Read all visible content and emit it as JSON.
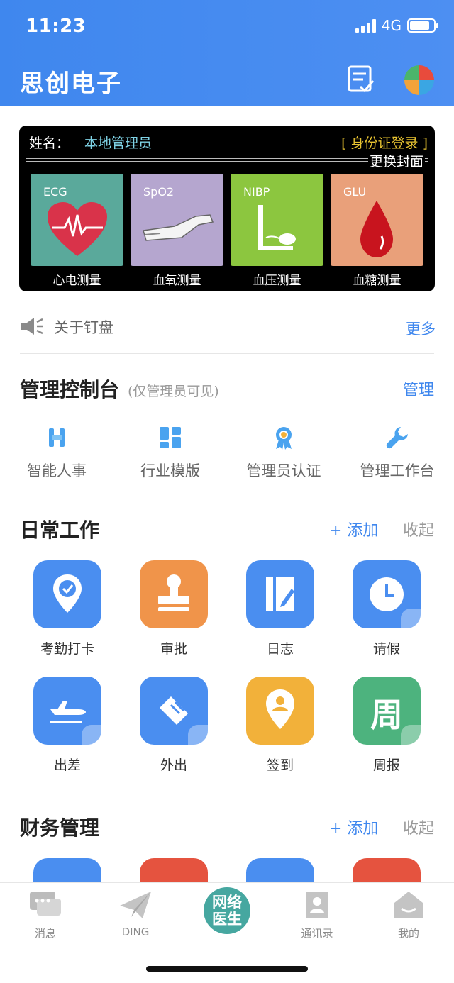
{
  "status_bar": {
    "time": "11:23",
    "network": "4G",
    "battery_level": 0.85
  },
  "header": {
    "title": "思创电子",
    "icons": [
      "tasks-icon",
      "avatar-icon"
    ]
  },
  "device_panel": {
    "name_label": "姓名：",
    "name_value": "本地管理员",
    "id_login": "[ 身份证登录 ]",
    "change_cover": "更换封面",
    "tiles": [
      {
        "tag": "ECG",
        "caption": "心电测量",
        "color": "#5aa99b",
        "icon": "heart-icon"
      },
      {
        "tag": "SpO2",
        "caption": "血氧测量",
        "color": "#b5a6cf",
        "icon": "pulse-oximeter-icon"
      },
      {
        "tag": "NIBP",
        "caption": "血压测量",
        "color": "#8cc63f",
        "icon": "blood-pressure-icon"
      },
      {
        "tag": "GLU",
        "caption": "血糖测量",
        "color": "#e9a07a",
        "icon": "blood-drop-icon"
      }
    ]
  },
  "notice": {
    "text": "关于钉盘",
    "more": "更多",
    "icon": "megaphone-icon"
  },
  "admin": {
    "title": "管理控制台",
    "subtitle": "(仅管理员可见)",
    "manage": "管理",
    "items": [
      {
        "label": "智能人事",
        "icon": "hr-icon"
      },
      {
        "label": "行业模版",
        "icon": "template-icon"
      },
      {
        "label": "管理员认证",
        "icon": "badge-icon"
      },
      {
        "label": "管理工作台",
        "icon": "wrench-icon"
      }
    ]
  },
  "daily": {
    "title": "日常工作",
    "add": "+ 添加",
    "collapse": "收起",
    "apps": [
      {
        "label": "考勤打卡",
        "color": "#4a8ef0",
        "icon": "location-check-icon"
      },
      {
        "label": "审批",
        "color": "#f0944a",
        "icon": "stamp-icon"
      },
      {
        "label": "日志",
        "color": "#4a8ef0",
        "icon": "journal-icon"
      },
      {
        "label": "请假",
        "color": "#4a8ef0",
        "icon": "clock-icon"
      },
      {
        "label": "出差",
        "color": "#4a8ef0",
        "icon": "airplane-icon"
      },
      {
        "label": "外出",
        "color": "#4a8ef0",
        "icon": "handshake-icon"
      },
      {
        "label": "签到",
        "color": "#f2b13a",
        "icon": "checkin-pin-icon"
      },
      {
        "label": "周报",
        "color": "#4db37e",
        "icon": "weekly-icon",
        "glyph": "周"
      }
    ]
  },
  "finance": {
    "title": "财务管理",
    "add": "+ 添加",
    "collapse": "收起"
  },
  "tabbar": {
    "tabs": [
      {
        "label": "消息",
        "icon": "chat-icon"
      },
      {
        "label": "DING",
        "icon": "paper-plane-icon"
      },
      {
        "label": "网络医生",
        "icon": "doctor-logo-icon",
        "line1": "网络",
        "line2": "医生"
      },
      {
        "label": "通讯录",
        "icon": "contacts-icon"
      },
      {
        "label": "我的",
        "icon": "home-icon"
      }
    ]
  }
}
